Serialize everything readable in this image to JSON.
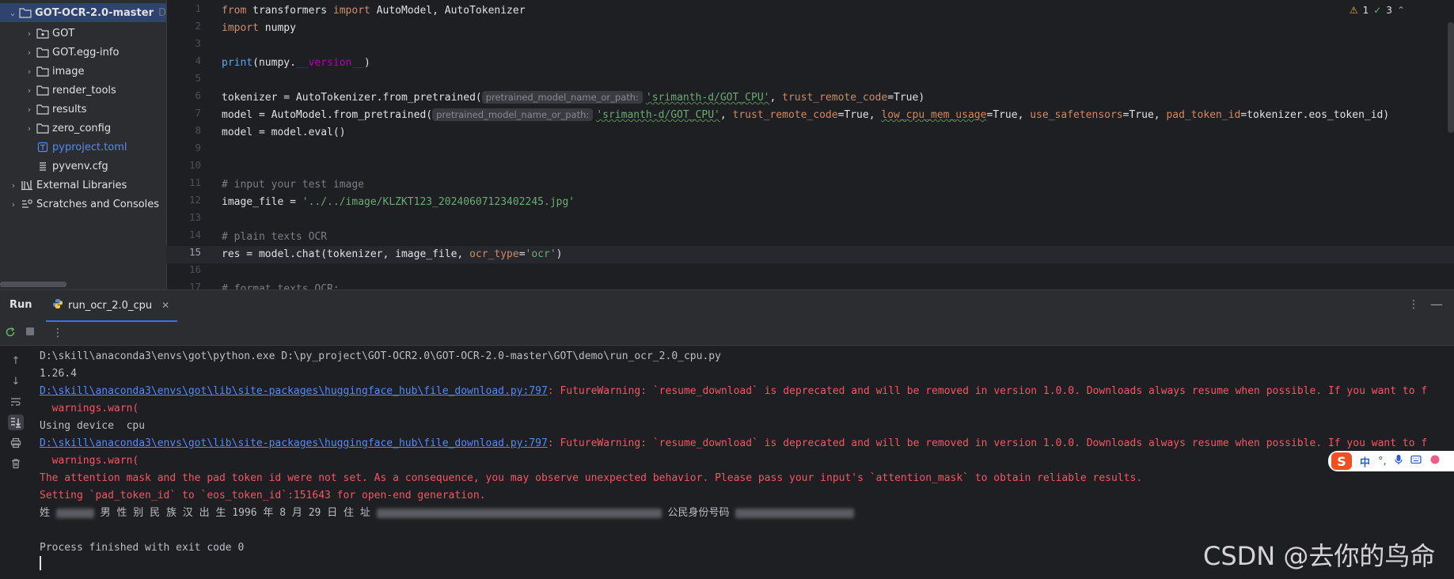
{
  "project_tree": {
    "root": {
      "label": "GOT-OCR-2.0-master",
      "suffix": "D"
    },
    "items": [
      {
        "label": "GOT",
        "type": "package"
      },
      {
        "label": "GOT.egg-info",
        "type": "folder"
      },
      {
        "label": "image",
        "type": "folder"
      },
      {
        "label": "render_tools",
        "type": "folder"
      },
      {
        "label": "results",
        "type": "folder"
      },
      {
        "label": "zero_config",
        "type": "folder"
      },
      {
        "label": "pyproject.toml",
        "type": "toml"
      },
      {
        "label": "pyvenv.cfg",
        "type": "cfg"
      }
    ],
    "external_libraries": "External Libraries",
    "scratches": "Scratches and Consoles"
  },
  "editor": {
    "line_numbers": [
      "1",
      "2",
      "3",
      "4",
      "5",
      "6",
      "7",
      "8",
      "9",
      "10",
      "11",
      "12",
      "13",
      "14",
      "15",
      "16",
      "17"
    ],
    "active_line": "15",
    "indicators": {
      "warnings": "1",
      "ok": "3"
    },
    "code": {
      "l1": {
        "kw1": "from",
        "mod": " transformers ",
        "kw2": "import",
        "rest": " AutoModel, AutoTokenizer"
      },
      "l2": {
        "kw": "import",
        "rest": " numpy"
      },
      "l4": {
        "fn": "print",
        "a": "(numpy.",
        "dunder": "__version__",
        "b": ")"
      },
      "l6": {
        "a": "tokenizer = AutoTokenizer.from_pretrained(",
        "hint": "pretrained_model_name_or_path:",
        "str": "'srimanth-d/GOT_CPU'",
        "c": ", ",
        "p1": "trust_remote_code",
        "d": "=True)"
      },
      "l7": {
        "a": "model = AutoModel.from_pretrained(",
        "hint": "pretrained_model_name_or_path:",
        "str": "'srimanth-d/GOT_CPU'",
        "c": ", ",
        "p1": "trust_remote_code",
        "e1": "=True, ",
        "p2": "low_cpu_mem_usage",
        "e2": "=True, ",
        "p3": "use_safetensors",
        "e3": "=True, ",
        "p4": "pad_token_id",
        "e4": "=tokenizer.eos_token_id)"
      },
      "l8": "model = model.eval()",
      "l11": "# input your test image",
      "l12": {
        "a": "image_file = ",
        "str": "'../../image/KLZKT123_20240607123402245.jpg'"
      },
      "l14": "# plain texts OCR",
      "l15": {
        "a": "res = model.chat(tokenizer, image_file, ",
        "p": "ocr_type",
        "b": "=",
        "str": "'ocr'",
        "c": ")"
      },
      "l17": "# format texts OCR:"
    }
  },
  "run": {
    "title": "Run",
    "tab": "run_ocr_2.0_cpu",
    "console": {
      "cmd": "D:\\skill\\anaconda3\\envs\\got\\python.exe D:\\py_project\\GOT-OCR2.0\\GOT-OCR-2.0-master\\GOT\\demo\\run_ocr_2.0_cpu.py",
      "version": "1.26.4",
      "warn_link": "D:\\skill\\anaconda3\\envs\\got\\lib\\site-packages\\huggingface_hub\\file_download.py:797",
      "warn_text": ": FutureWarning: `resume_download` is deprecated and will be removed in version 1.0.0. Downloads always resume when possible. If you want to f",
      "warnings_warn": "  warnings.warn(",
      "device": "Using device  cpu",
      "attention": "The attention mask and the pad token id were not set. As a consequence, you may observe unexpected behavior. Please pass your input's `attention_mask` to obtain reliable results.",
      "pad_token": "Setting `pad_token_id` to `eos_token_id`:151643 for open-end generation.",
      "ocr_a": "姓 ",
      "ocr_b": " 男 性 别 民 族 汉 出 生 1996 年 8 月 29 日 住 址 ",
      "ocr_c": " 公民身份号码 ",
      "exit": "Process finished with exit code 0"
    }
  },
  "ime": {
    "zh": "中",
    "dot": "°,"
  },
  "watermark": "CSDN @去你的鸟命"
}
